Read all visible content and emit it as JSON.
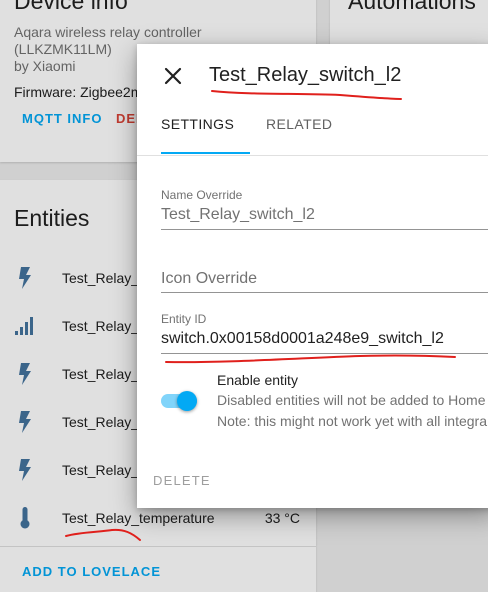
{
  "device_card": {
    "title": "Device info",
    "model": "Aqara wireless relay controller",
    "model_id": "(LLKZMK11LM)",
    "manufacturer": "by Xiaomi",
    "firmware": "Firmware: Zigbee2m",
    "mqtt_info_label": "MQTT INFO",
    "delete_label": "DEL"
  },
  "automations_card": {
    "title": "Automations"
  },
  "entities_card": {
    "title": "Entities",
    "rows": [
      {
        "name": "Test_Relay_c",
        "icon": "flash-icon",
        "value": ""
      },
      {
        "name": "Test_Relay_l",
        "icon": "signal-icon",
        "value": ""
      },
      {
        "name": "Test_Relay_p",
        "icon": "flash-icon",
        "value": ""
      },
      {
        "name": "Test_Relay_s",
        "icon": "flash-icon",
        "value": ""
      },
      {
        "name": "Test_Relay_s",
        "icon": "flash-icon",
        "value": ""
      },
      {
        "name": "Test_Relay_temperature",
        "icon": "thermometer-icon",
        "value": "33 °C"
      }
    ],
    "add_to_lovelace_label": "ADD TO LOVELACE"
  },
  "dialog": {
    "title": "Test_Relay_switch_l2",
    "tabs": [
      "SETTINGS",
      "RELATED"
    ],
    "name_override_label": "Name Override",
    "name_override_value": "Test_Relay_switch_l2",
    "icon_override_placeholder": "Icon Override",
    "entity_id_label": "Entity ID",
    "entity_id_value": "switch.0x00158d0001a248e9_switch_l2",
    "enable_entity_label": "Enable entity",
    "enable_entity_checked": true,
    "enable_help_1": "Disabled entities will not be added to Home",
    "enable_help_2": "Note: this might not work yet with all integra",
    "delete_label": "DELETE"
  },
  "colors": {
    "accent": "#03a9f4",
    "annotation": "#e0201c",
    "icon": "#44739e"
  }
}
